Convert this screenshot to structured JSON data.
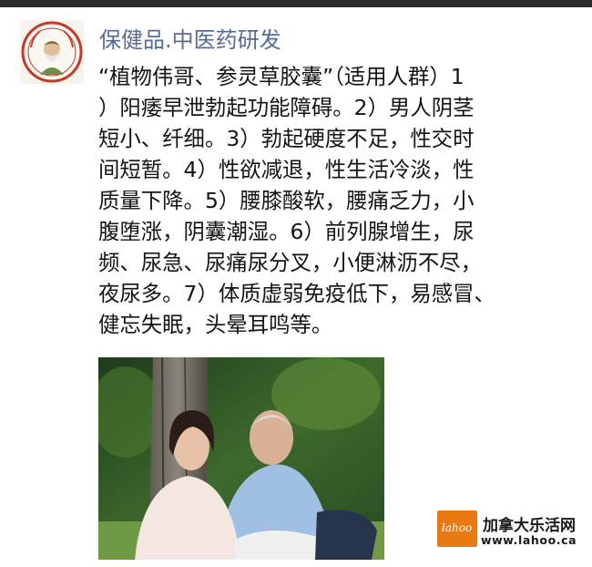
{
  "post": {
    "author": "保健品.中医药研发",
    "text": "“植物伟哥、参灵草胶囊”（适用人群）1\n）阳痿早泄勃起功能障碍。2）男人阴茎\n短小、纤细。3）勃起硬度不足，性交时\n间短暂。4）性欲减退，性生活冷淡，性\n质量下降。5）腰膝酸软，腰痛乏力，小\n腹堕涨，阴囊潮湿。6）前列腺增生，尿\n频、尿急、尿痛尿分叉，小便淋沥不尽，\n夜尿多。7）体质虚弱免疫低下，易感冒、\n健忘失眠，头晕耳鸣等。"
  },
  "watermark": {
    "logo_text": "lahoo",
    "site_name": "加拿大乐活网",
    "url": "www.lahoo.ca"
  }
}
